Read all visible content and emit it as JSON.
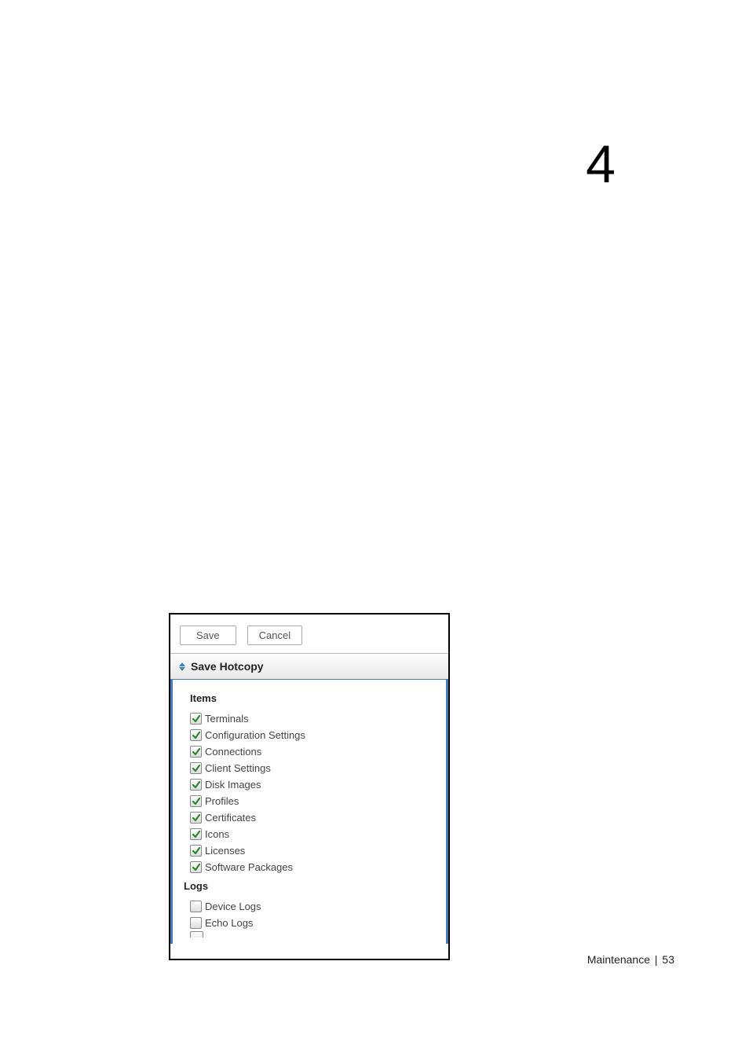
{
  "page_number": "4",
  "footer": {
    "section": "Maintenance",
    "separator": "|",
    "page": "53"
  },
  "panel": {
    "toolbar": {
      "save_label": "Save",
      "cancel_label": "Cancel"
    },
    "header": {
      "title": "Save Hotcopy"
    },
    "groups": {
      "items_label": "Items",
      "logs_label": "Logs"
    },
    "items": [
      {
        "label": "Terminals",
        "checked": true
      },
      {
        "label": "Configuration Settings",
        "checked": true
      },
      {
        "label": "Connections",
        "checked": true
      },
      {
        "label": "Client Settings",
        "checked": true
      },
      {
        "label": "Disk Images",
        "checked": true
      },
      {
        "label": "Profiles",
        "checked": true
      },
      {
        "label": "Certificates",
        "checked": true
      },
      {
        "label": "Icons",
        "checked": true
      },
      {
        "label": "Licenses",
        "checked": true
      },
      {
        "label": "Software Packages",
        "checked": true
      }
    ],
    "logs": [
      {
        "label": "Device Logs",
        "checked": false
      },
      {
        "label": "Echo Logs",
        "checked": false
      }
    ]
  }
}
